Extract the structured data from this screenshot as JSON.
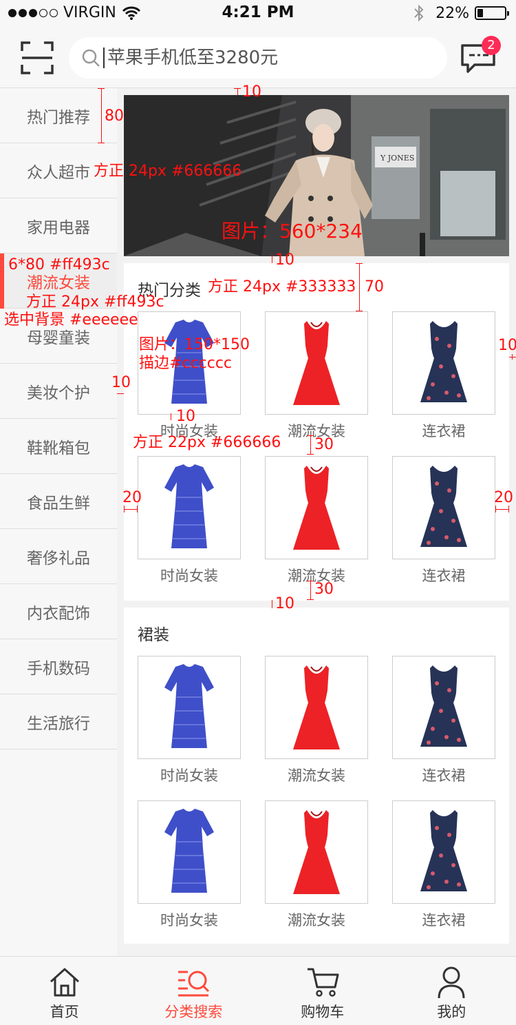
{
  "status_bar": {
    "carrier": "VIRGIN",
    "time": "4:21 PM",
    "battery": "22%",
    "battery_level": 0.22
  },
  "search": {
    "placeholder": "苹果手机低至3280元"
  },
  "messages": {
    "badge": "2"
  },
  "sidebar": {
    "items": [
      {
        "label": "热门推荐"
      },
      {
        "label": "众人超市"
      },
      {
        "label": "家用电器"
      },
      {
        "label": "潮流女装",
        "active": true
      },
      {
        "label": "母婴童装"
      },
      {
        "label": "美妆个护"
      },
      {
        "label": "鞋靴箱包"
      },
      {
        "label": "食品生鲜"
      },
      {
        "label": "奢侈礼品"
      },
      {
        "label": "内衣配饰"
      },
      {
        "label": "手机数码"
      },
      {
        "label": "生活旅行"
      }
    ]
  },
  "sections": [
    {
      "title": "热门分类",
      "products": [
        {
          "label": "时尚女装",
          "image": "blue-lace-dress"
        },
        {
          "label": "潮流女装",
          "image": "red-dress"
        },
        {
          "label": "连衣裙",
          "image": "floral-navy-dress"
        },
        {
          "label": "时尚女装",
          "image": "blue-lace-dress"
        },
        {
          "label": "潮流女装",
          "image": "red-dress"
        },
        {
          "label": "连衣裙",
          "image": "floral-navy-dress"
        }
      ]
    },
    {
      "title": "裙装",
      "products": [
        {
          "label": "时尚女装",
          "image": "blue-lace-dress"
        },
        {
          "label": "潮流女装",
          "image": "red-dress"
        },
        {
          "label": "连衣裙",
          "image": "floral-navy-dress"
        },
        {
          "label": "时尚女装",
          "image": "blue-lace-dress"
        },
        {
          "label": "潮流女装",
          "image": "red-dress"
        },
        {
          "label": "连衣裙",
          "image": "floral-navy-dress"
        }
      ]
    }
  ],
  "tabbar": {
    "items": [
      {
        "label": "首页",
        "icon": "home-icon"
      },
      {
        "label": "分类搜索",
        "icon": "category-search-icon",
        "active": true
      },
      {
        "label": "购物车",
        "icon": "cart-icon"
      },
      {
        "label": "我的",
        "icon": "user-icon"
      }
    ]
  },
  "annotations": {
    "banner_top_gap": "10",
    "sidebar_item_height": "80",
    "sidebar_font": "方正 24px #666666",
    "banner_size": "图片：560*234",
    "banner_bottom_gap": "10",
    "section_header_height": "70",
    "section_title_font": "方正 24px #333333",
    "active_bar": "6*80 #ff493c",
    "active_font": "方正 24px #ff493c",
    "active_bg": "选中背景 #eeeeee",
    "thumb_size": "图片：150*150",
    "thumb_border": "描边#cccccc",
    "right_gap": "10",
    "left_gap": "10",
    "label_gap": "10",
    "label_font": "方正 22px #666666",
    "row_gap": "30",
    "side_padding_left": "20",
    "side_padding_right": "20",
    "row_gap_2": "30",
    "section_gap": "10"
  },
  "colors": {
    "accent": "#ff493c",
    "sidebar_text": "#666666",
    "title_text": "#333333",
    "border": "#cccccc",
    "badge": "#ff2b57"
  }
}
